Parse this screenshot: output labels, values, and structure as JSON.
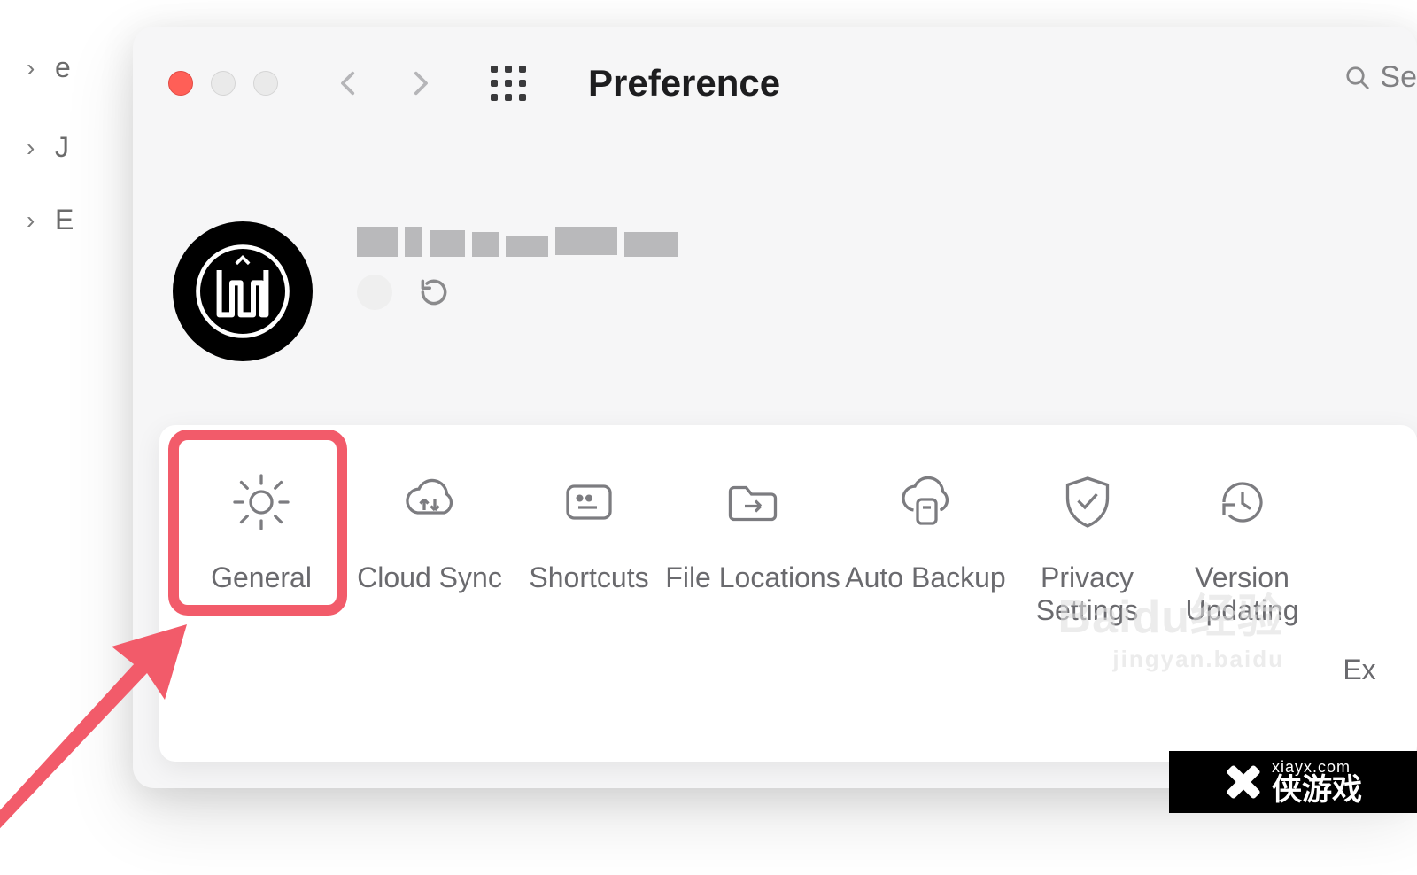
{
  "sidebar": {
    "items": [
      "e",
      "J",
      "E"
    ]
  },
  "window": {
    "title": "Preference",
    "search_placeholder": "Se"
  },
  "tabs": [
    {
      "label": "General"
    },
    {
      "label": "Cloud Sync"
    },
    {
      "label": "Shortcuts"
    },
    {
      "label": "File Locations"
    },
    {
      "label": "Auto Backup"
    },
    {
      "label": "Privacy\nSettings"
    },
    {
      "label": "Version\nUpdating"
    },
    {
      "label": "Ex"
    }
  ],
  "watermark": {
    "brand": "Baidu经验",
    "sub": "jingyan.baidu"
  },
  "corner": {
    "domain": "xiayx.com",
    "text": "侠游戏"
  }
}
